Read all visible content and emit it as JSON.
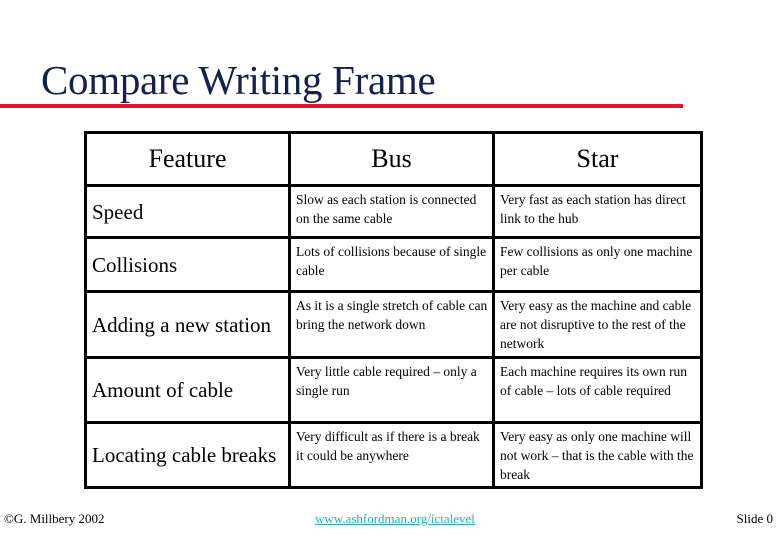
{
  "slide": {
    "title": "Compare Writing Frame",
    "accent_colors": {
      "title": "#14204f",
      "rule": "#e2142d",
      "link": "#20b2b2"
    }
  },
  "table": {
    "headers": [
      "Feature",
      "Bus",
      "Star"
    ],
    "rows": [
      {
        "feature": "Speed",
        "bus": "Slow as each station is connected on the same cable",
        "star": "Very fast as each station has direct link to the hub"
      },
      {
        "feature": "Collisions",
        "bus": "Lots of collisions because of single cable",
        "star": "Few collisions as only one machine per cable"
      },
      {
        "feature": "Adding a new station",
        "bus": "As it is a single stretch of cable can bring the network down",
        "star": "Very easy as the machine and cable are not disruptive to the rest of the network"
      },
      {
        "feature": "Amount of cable",
        "bus": "Very little cable required – only a single run",
        "star": "Each machine requires its own run of cable – lots of cable required"
      },
      {
        "feature": "Locating cable breaks",
        "bus": "Very difficult as if there is a break it could be anywhere",
        "star": "Very easy as only one machine will not work – that is the cable with the break"
      }
    ]
  },
  "footer": {
    "copyright": "©G. Millbery 2002",
    "link": "www.ashfordman.org/ictalevel",
    "slide_number": "Slide 0"
  }
}
